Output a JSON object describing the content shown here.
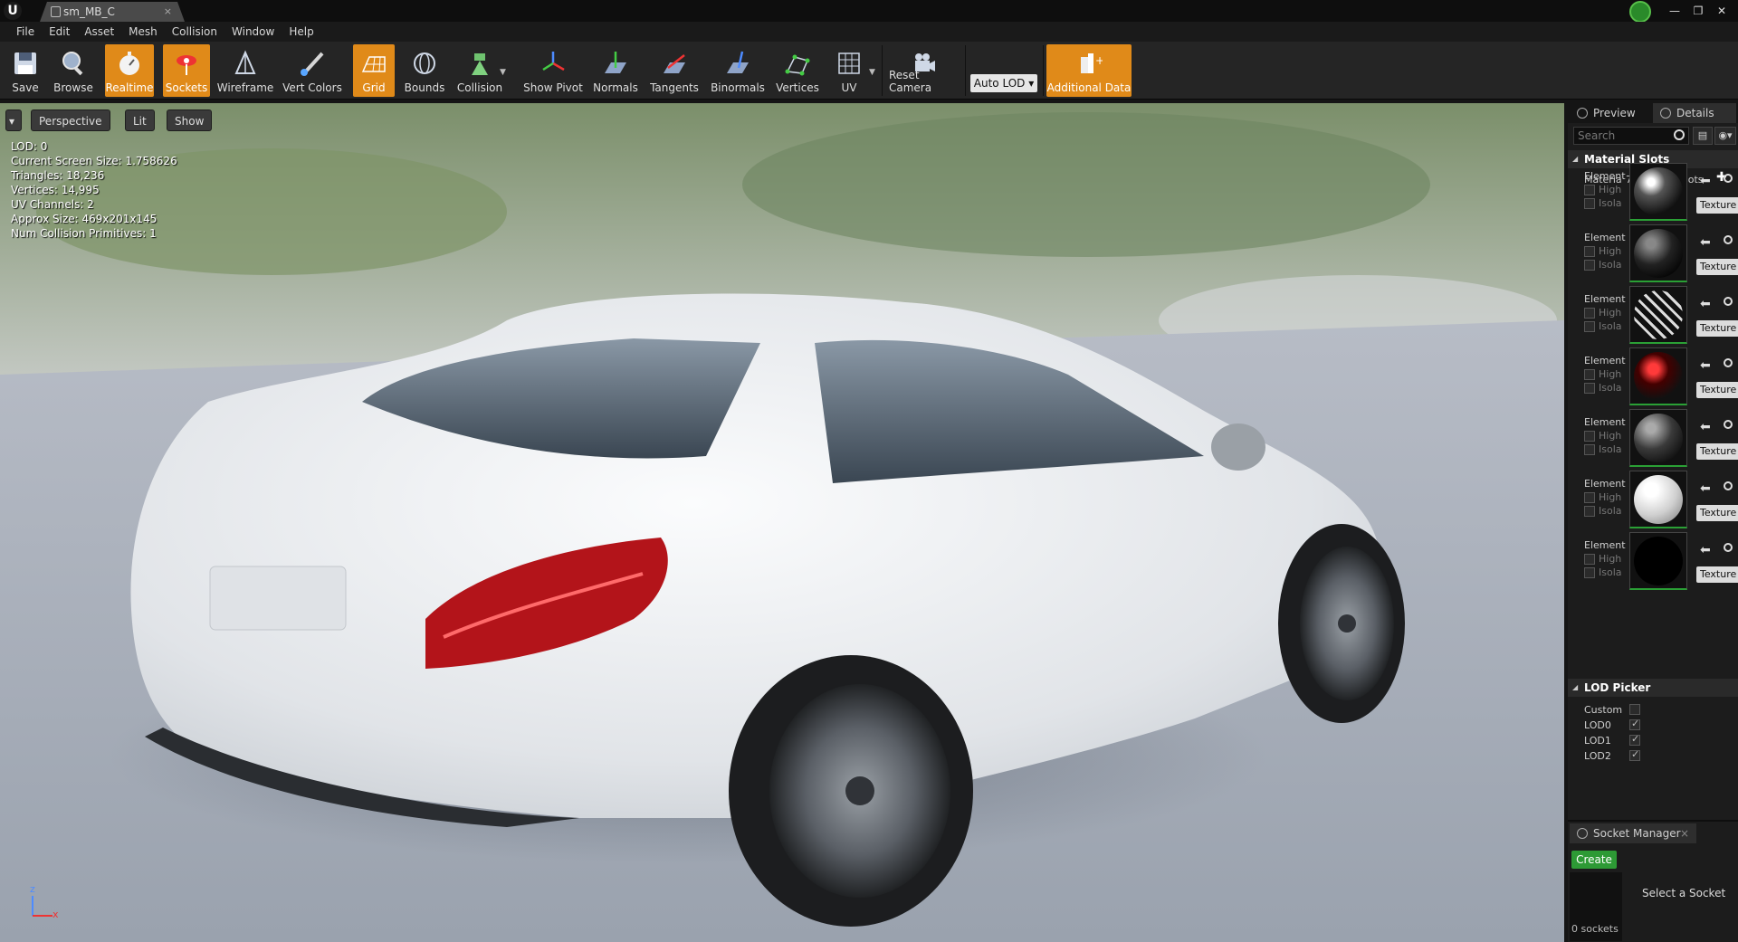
{
  "window": {
    "tab_title": "sm_MB_C",
    "logo": "U",
    "controls": [
      "—",
      "❐",
      "✕"
    ]
  },
  "menu": [
    "File",
    "Edit",
    "Asset",
    "Mesh",
    "Collision",
    "Window",
    "Help"
  ],
  "toolbar": {
    "save": "Save",
    "browse": "Browse",
    "realtime": "Realtime",
    "sockets": "Sockets",
    "wireframe": "Wireframe",
    "vert_colors": "Vert Colors",
    "grid": "Grid",
    "bounds": "Bounds",
    "collision": "Collision",
    "show_pivot": "Show Pivot",
    "normals": "Normals",
    "tangents": "Tangents",
    "binormals": "Binormals",
    "vertices": "Vertices",
    "uv": "UV",
    "reset_camera": "Reset Camera",
    "auto_lod": "Auto LOD",
    "additional_data": "Additional Data"
  },
  "viewport": {
    "perspective": "Perspective",
    "lit": "Lit",
    "show": "Show",
    "stats": [
      "LOD:  0",
      "Current Screen Size:  1.758626",
      "Triangles:  18,236",
      "Vertices:  14,995",
      "UV Channels:  2",
      "Approx Size: 469x201x145",
      "Num Collision Primitives:  1"
    ],
    "axis_z": "z",
    "axis_x": "x"
  },
  "panel": {
    "tab_preview": "Preview",
    "tab_details": "Details",
    "search_placeholder": "Search",
    "material_slots_header": "Material Slots",
    "material_label": "Materia",
    "material_count": "7 Material Slots",
    "element_label": "Element",
    "highlight_label": "High",
    "isolate_label": "Isola",
    "texture_label": "Texture",
    "lod_picker_header": "LOD Picker",
    "lod_rows": [
      {
        "label": "Custom",
        "checked": false
      },
      {
        "label": "LOD0",
        "checked": true
      },
      {
        "label": "LOD1",
        "checked": true
      },
      {
        "label": "LOD2",
        "checked": true
      }
    ]
  },
  "socket_manager": {
    "title": "Socket Manager",
    "create": "Create",
    "count": "0 sockets",
    "select_hint": "Select a Socket"
  },
  "colors": {
    "accent_orange": "#e08a19",
    "create_green": "#2d9a35",
    "car_white": "#eceef0"
  }
}
